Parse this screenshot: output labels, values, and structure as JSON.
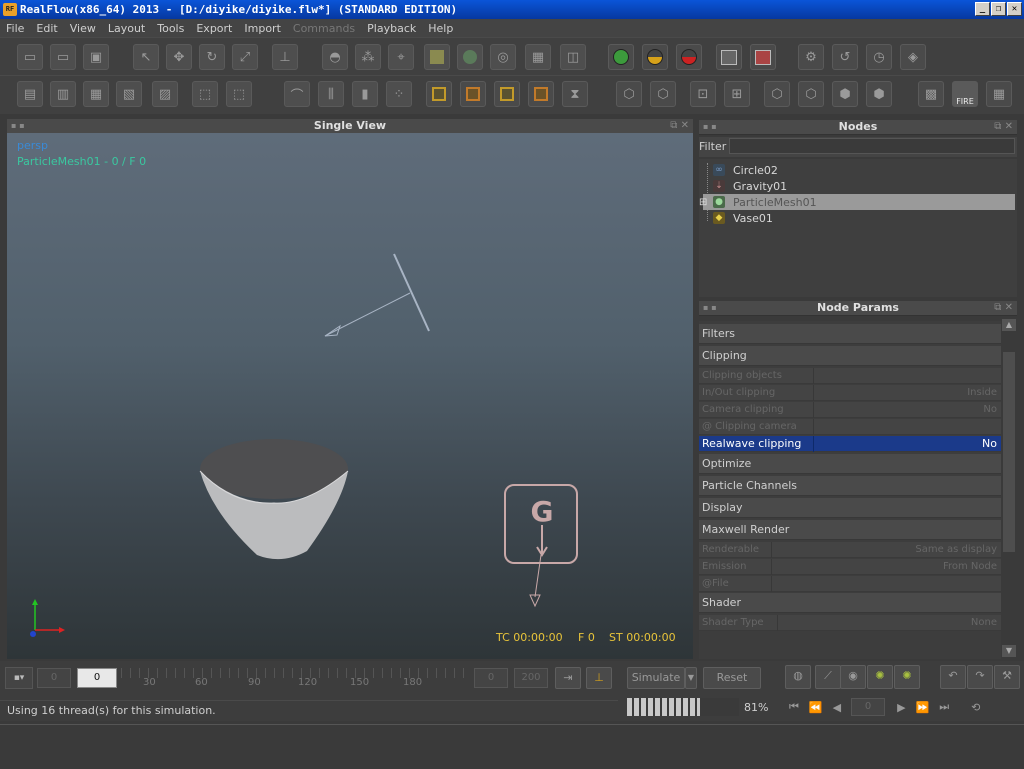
{
  "window": {
    "logo_text": "RF",
    "title": "RealFlow(x86_64) 2013 - [D:/diyike/diyike.flw*] (STANDARD EDITION)",
    "controls": [
      "_",
      "❐",
      "✕"
    ]
  },
  "menu": [
    {
      "label": "File",
      "enabled": true
    },
    {
      "label": "Edit",
      "enabled": true
    },
    {
      "label": "View",
      "enabled": true
    },
    {
      "label": "Layout",
      "enabled": true
    },
    {
      "label": "Tools",
      "enabled": true
    },
    {
      "label": "Export",
      "enabled": true
    },
    {
      "label": "Import",
      "enabled": true
    },
    {
      "label": "Commands",
      "enabled": false
    },
    {
      "label": "Playback",
      "enabled": true
    },
    {
      "label": "Help",
      "enabled": true
    }
  ],
  "toolbar": {
    "fire_label": "FIRE"
  },
  "viewport": {
    "title": "Single View",
    "camera": "persp",
    "selected_object": "ParticleMesh01 - 0 / F 0",
    "gravity_letter": "G",
    "timecode": "TC 00:00:00",
    "frame": "F 0",
    "sim_time": "ST 00:00:00"
  },
  "nodes": {
    "title": "Nodes",
    "filter_label": "Filter",
    "filter_value": "",
    "items": [
      {
        "label": "Circle02",
        "icon": "emitter-icon",
        "color": "#7a9ac4",
        "selected": false
      },
      {
        "label": "Gravity01",
        "icon": "daemon-icon",
        "color": "#c08a8a",
        "selected": false
      },
      {
        "label": "ParticleMesh01",
        "icon": "mesh-icon",
        "color": "#7cb87c",
        "selected": true
      },
      {
        "label": "Vase01",
        "icon": "object-icon",
        "color": "#d8c04a",
        "selected": false
      }
    ]
  },
  "params": {
    "title": "Node Params",
    "sections": {
      "filters": "Filters",
      "clipping": "Clipping",
      "optimize": "Optimize",
      "particle_channels": "Particle Channels",
      "display": "Display",
      "maxwell": "Maxwell Render",
      "shader": "Shader"
    },
    "clipping_rows": [
      {
        "label": "Clipping objects",
        "value": ""
      },
      {
        "label": "In/Out clipping",
        "value": "Inside"
      },
      {
        "label": "Camera clipping",
        "value": "No"
      },
      {
        "label": "@ Clipping camera",
        "value": ""
      },
      {
        "label": "Realwave clipping",
        "value": "No",
        "highlight": true
      }
    ],
    "maxwell_rows": [
      {
        "label": "Renderable",
        "value": "Same as display"
      },
      {
        "label": "Emission",
        "value": "From Node"
      },
      {
        "label": "@File",
        "value": ""
      }
    ],
    "shader_rows": [
      {
        "label": "Shader Type",
        "value": "None"
      }
    ]
  },
  "timeline": {
    "start": "0",
    "current": "0",
    "ticks": [
      "30",
      "60",
      "90",
      "120",
      "150",
      "180"
    ],
    "end1": "0",
    "end2": "200"
  },
  "controls": {
    "simulate": "Simulate",
    "reset": "Reset",
    "progress_percent": "81%",
    "progress": 0.81,
    "frame_field": "0"
  },
  "status": {
    "message": "Using 16 thread(s) for this simulation."
  }
}
